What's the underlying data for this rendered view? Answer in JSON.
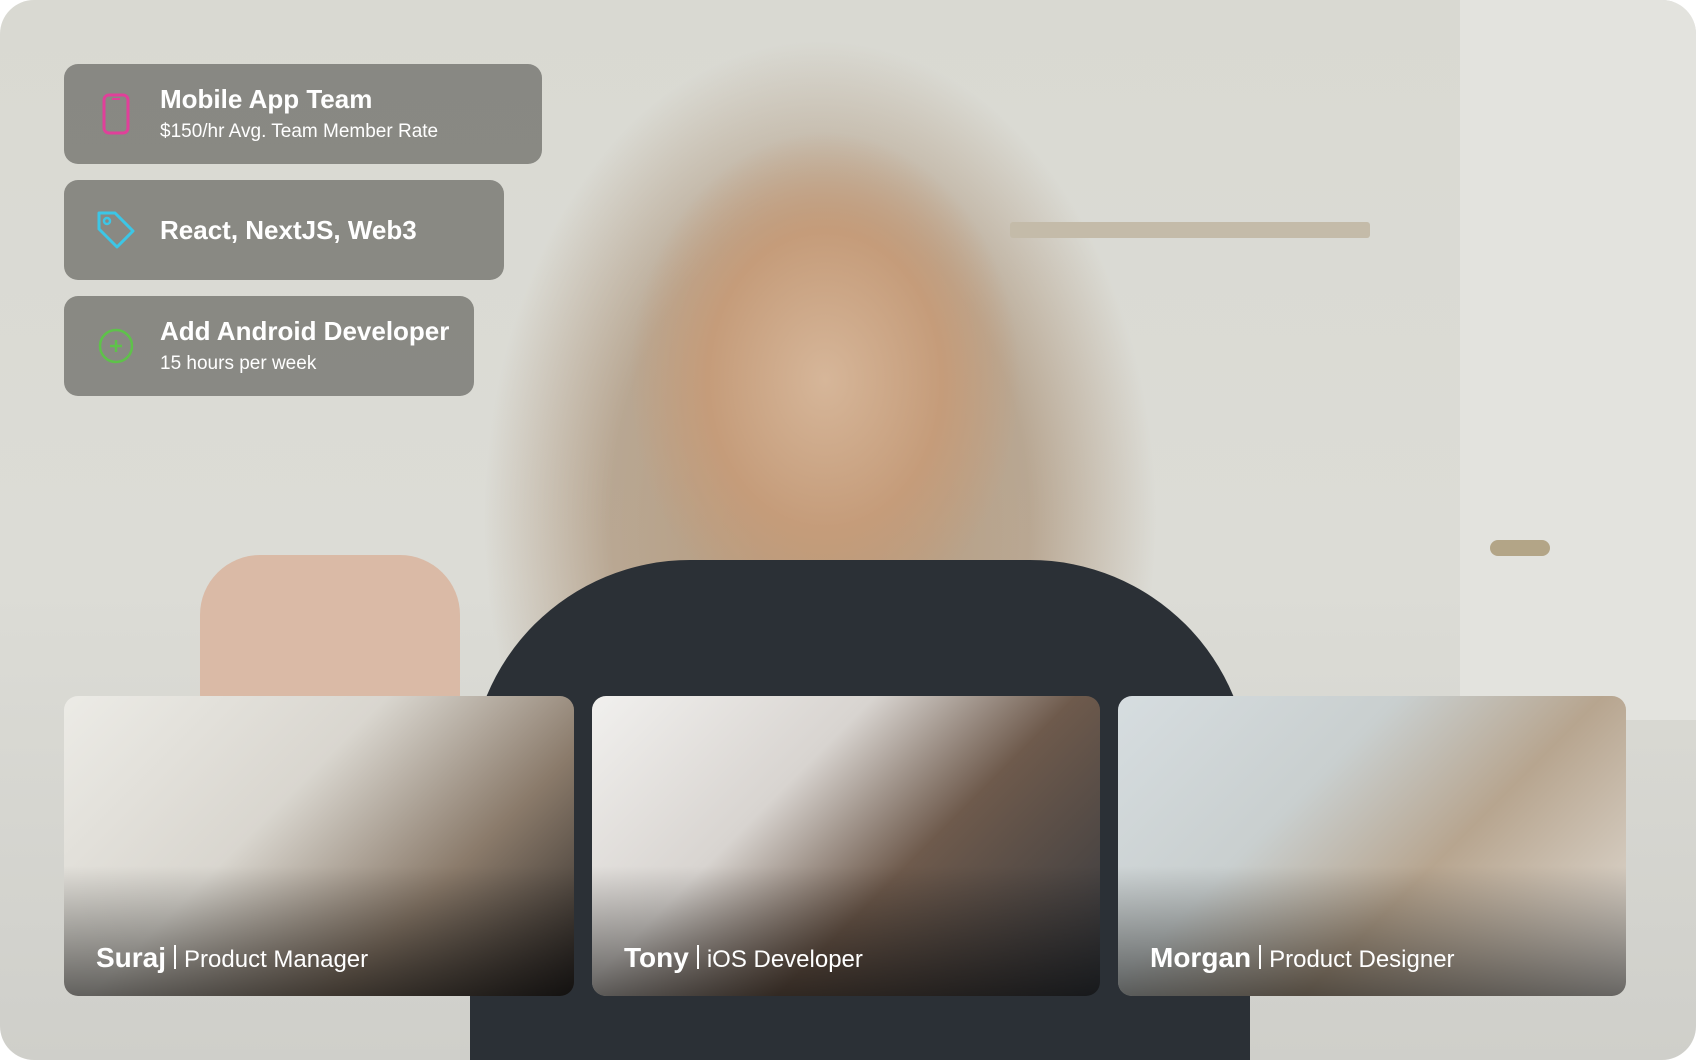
{
  "cards": [
    {
      "title": "Mobile App Team",
      "subtitle": "$150/hr Avg. Team Member Rate",
      "icon": "phone-icon",
      "icon_color": "#e0409a"
    },
    {
      "title": "React, NextJS, Web3",
      "icon": "tag-icon",
      "icon_color": "#3cc6e6"
    },
    {
      "title": "Add Android Developer",
      "subtitle": "15 hours per week",
      "icon": "plus-circle-icon",
      "icon_color": "#5ec24a"
    }
  ],
  "participants": [
    {
      "name": "Suraj",
      "role": "Product Manager"
    },
    {
      "name": "Tony",
      "role": "iOS Developer"
    },
    {
      "name": "Morgan",
      "role": "Product Designer"
    }
  ]
}
